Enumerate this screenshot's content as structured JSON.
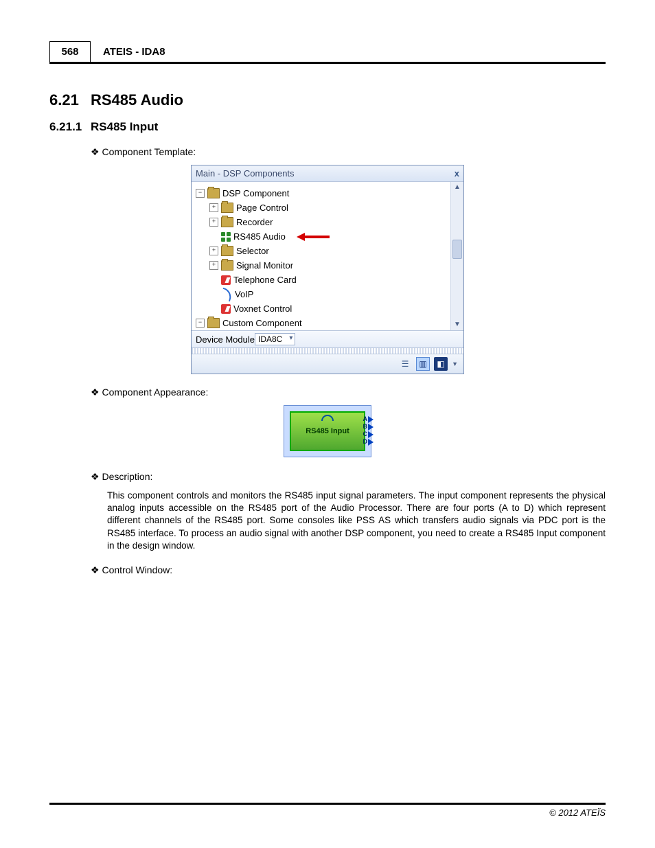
{
  "header": {
    "page_number": "568",
    "doc_title": "ATEIS - IDA8"
  },
  "section": {
    "num": "6.21",
    "title": "RS485 Audio"
  },
  "subsection": {
    "num": "6.21.1",
    "title": "RS485 Input"
  },
  "bullets": {
    "template": "Component Template:",
    "appearance": "Component Appearance:",
    "description": "Description:",
    "control": "Control Window:"
  },
  "panel": {
    "title": "Main - DSP Components",
    "close": "x",
    "tree": {
      "root": "DSP Component",
      "items": [
        {
          "label": "Page Control",
          "expand": "+",
          "icon": "folder"
        },
        {
          "label": "Recorder",
          "expand": "+",
          "icon": "folder"
        },
        {
          "label": "RS485 Audio",
          "expand": "",
          "icon": "grid",
          "arrow": true
        },
        {
          "label": "Selector",
          "expand": "+",
          "icon": "folder"
        },
        {
          "label": "Signal Monitor",
          "expand": "+",
          "icon": "folder"
        },
        {
          "label": "Telephone Card",
          "expand": "",
          "icon": "tel"
        },
        {
          "label": "VoIP",
          "expand": "",
          "icon": "voip"
        },
        {
          "label": "Voxnet Control",
          "expand": "",
          "icon": "tel"
        }
      ],
      "root2": "Custom Component"
    },
    "device_label": "Device Module",
    "device_value": "IDA8C"
  },
  "component": {
    "label": "RS485 Input",
    "ports": [
      "A",
      "B",
      "C",
      "D"
    ]
  },
  "description_text": "This component controls and monitors the RS485 input signal parameters. The input component represents the physical analog inputs accessible on the RS485 port of the Audio Processor. There are four ports (A to D) which represent different channels of the RS485 port. Some consoles like PSS AS which transfers audio signals via PDC port is the RS485 interface. To process an audio signal with another DSP component, you need to create a RS485 Input component in the design window.",
  "footer": "© 2012 ATEÏS"
}
